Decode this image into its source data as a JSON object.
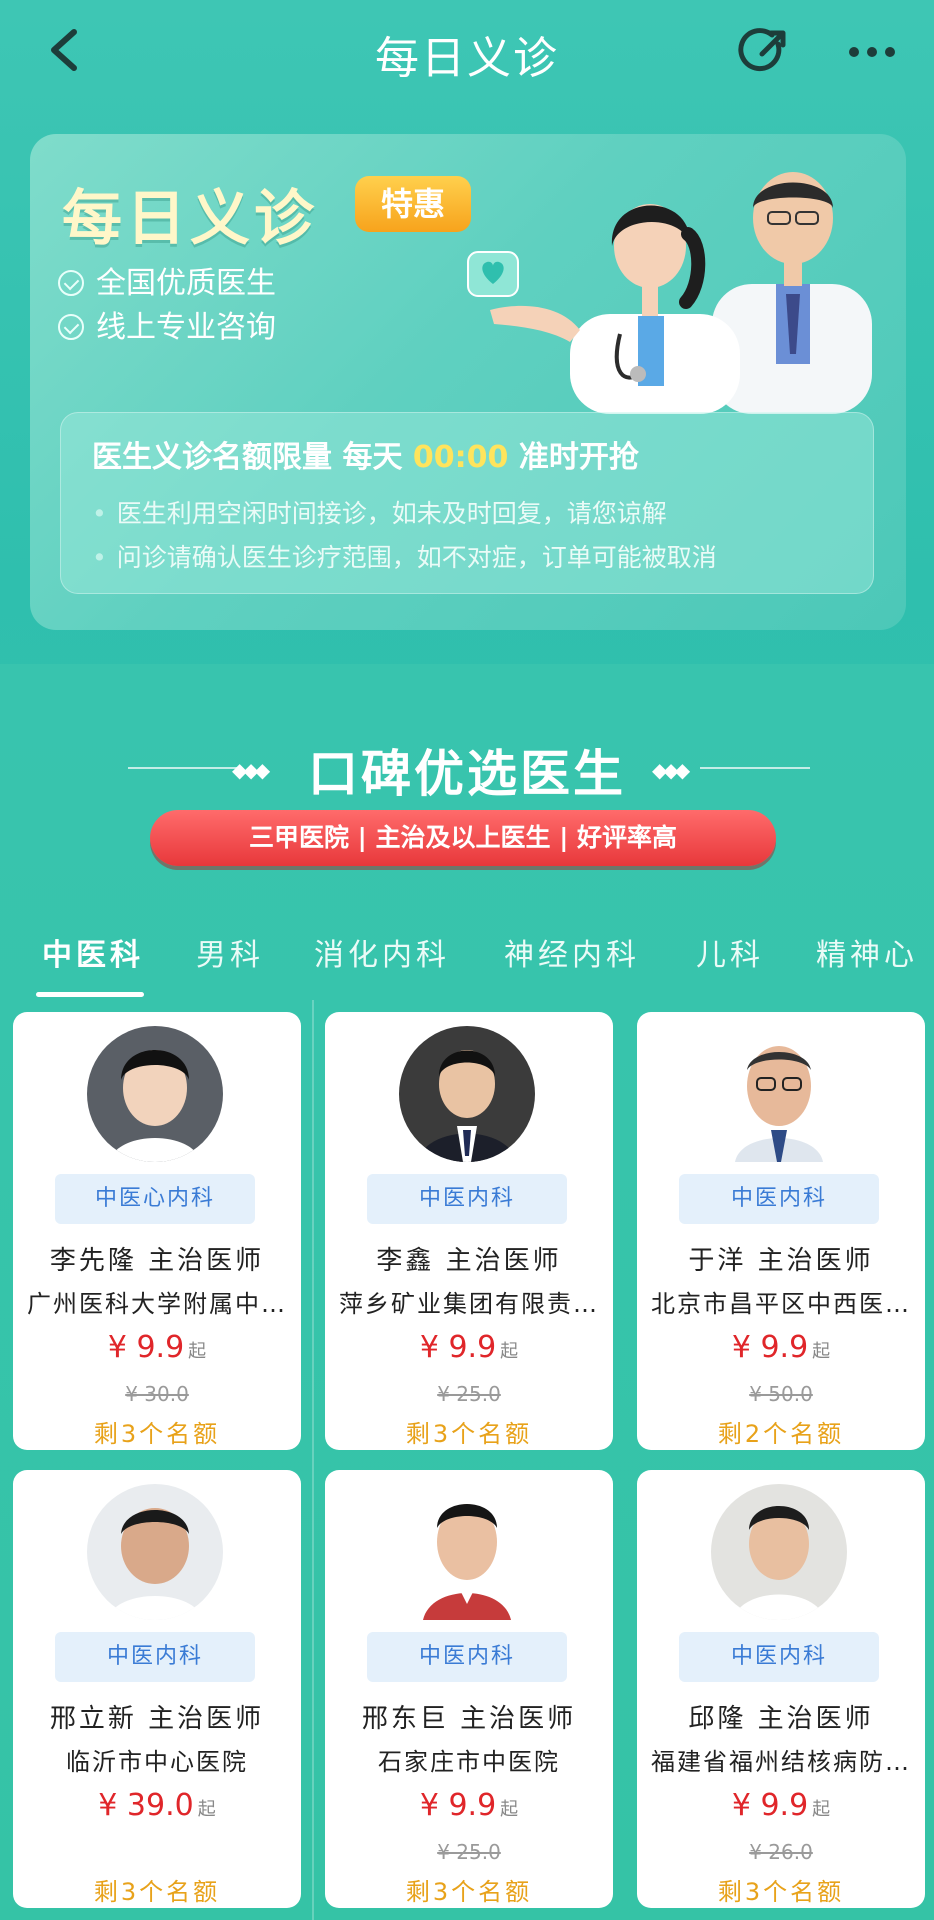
{
  "header": {
    "title": "每日义诊"
  },
  "banner": {
    "title": "每日义诊",
    "badge": "特惠",
    "features": [
      "全国优质医生",
      "线上专业咨询"
    ],
    "notice_prefix": "医生义诊名额限量 每天 ",
    "notice_time": "00:00",
    "notice_suffix": " 准时开抢",
    "notice_bullets": [
      "医生利用空闲时间接诊，如未及时回复，请您谅解",
      "问诊请确认医生诊疗范围，如不对症，订单可能被取消"
    ]
  },
  "section": {
    "title": "口碑优选医生",
    "pill": "三甲医院 | 主治及以上医生 | 好评率高"
  },
  "tabs": [
    "中医科",
    "男科",
    "消化内科",
    "神经内科",
    "儿科",
    "精神心"
  ],
  "doctors": [
    {
      "dept": "中医心内科",
      "name": "李先隆  主治医师",
      "hospital": "广州医科大学附属中…",
      "price": "¥ 9.9",
      "qi": "起",
      "original": "¥ 30.0",
      "remain": "剩3个名额"
    },
    {
      "dept": "中医内科",
      "name": "李鑫  主治医师",
      "hospital": "萍乡矿业集团有限责…",
      "price": "¥ 9.9",
      "qi": "起",
      "original": "¥ 25.0",
      "remain": "剩3个名额"
    },
    {
      "dept": "中医内科",
      "name": "于洋  主治医师",
      "hospital": "北京市昌平区中西医…",
      "price": "¥ 9.9",
      "qi": "起",
      "original": "¥ 50.0",
      "remain": "剩2个名额"
    },
    {
      "dept": "中医内科",
      "name": "邢立新  主治医师",
      "hospital": "临沂市中心医院",
      "price": "¥ 39.0",
      "qi": "起",
      "original": "",
      "remain": "剩3个名额"
    },
    {
      "dept": "中医内科",
      "name": "邢东巨  主治医师",
      "hospital": "石家庄市中医院",
      "price": "¥ 9.9",
      "qi": "起",
      "original": "¥ 25.0",
      "remain": "剩3个名额"
    },
    {
      "dept": "中医内科",
      "name": "邱隆  主治医师",
      "hospital": "福建省福州结核病防…",
      "price": "¥ 9.9",
      "qi": "起",
      "original": "¥ 26.0",
      "remain": "剩3个名额"
    }
  ],
  "colors": {
    "accent": "#3ec6b4",
    "price_red": "#e0262a",
    "remain_orange": "#e8a21a",
    "dept_blue": "#3a7bd5"
  }
}
